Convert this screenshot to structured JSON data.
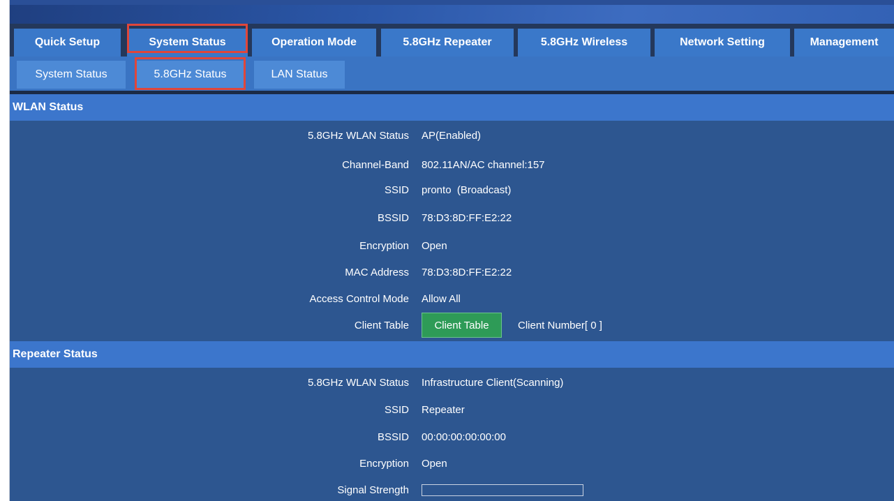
{
  "main_nav": [
    {
      "label": "Quick Setup"
    },
    {
      "label": "System Status"
    },
    {
      "label": "Operation Mode"
    },
    {
      "label": "5.8GHz Repeater"
    },
    {
      "label": "5.8GHz Wireless"
    },
    {
      "label": "Network Setting"
    },
    {
      "label": "Management"
    }
  ],
  "sub_nav": [
    {
      "label": "System Status"
    },
    {
      "label": "5.8GHz Status"
    },
    {
      "label": "LAN Status"
    }
  ],
  "wlan": {
    "title": "WLAN Status",
    "rows": [
      {
        "label": "5.8GHz WLAN Status",
        "value": "AP(Enabled)"
      },
      {
        "label": "Channel-Band",
        "value": "802.11AN/AC channel:157"
      },
      {
        "label": "SSID",
        "value": "pronto  (Broadcast)"
      },
      {
        "label": "BSSID",
        "value": "78:D3:8D:FF:E2:22"
      },
      {
        "label": "Encryption",
        "value": "Open"
      },
      {
        "label": "MAC Address",
        "value": "78:D3:8D:FF:E2:22"
      },
      {
        "label": "Access Control Mode",
        "value": "Allow All"
      }
    ],
    "client_table_label": "Client Table",
    "client_table_button": "Client Table",
    "client_number": "Client Number[ 0 ]"
  },
  "repeater": {
    "title": "Repeater Status",
    "rows": [
      {
        "label": "5.8GHz WLAN Status",
        "value": "Infrastructure Client(Scanning)"
      },
      {
        "label": "SSID",
        "value": "Repeater"
      },
      {
        "label": "BSSID",
        "value": "00:00:00:00:00:00"
      },
      {
        "label": "Encryption",
        "value": "Open"
      }
    ],
    "signal_label": "Signal Strength",
    "signal_strength": 0
  },
  "colors": {
    "page_bg": "#2d5690",
    "tab_bg": "#3a78c9",
    "section_header": "#3c76cc",
    "button_green": "#2e9b57",
    "highlight_red": "#e0463a"
  }
}
